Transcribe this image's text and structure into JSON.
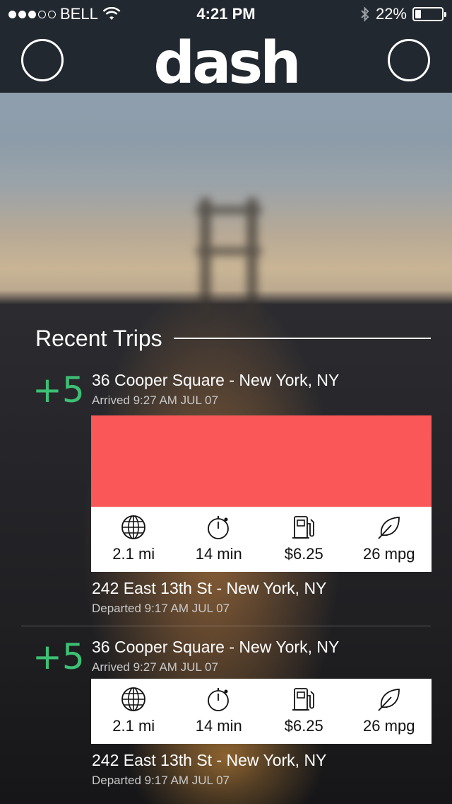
{
  "status_bar": {
    "carrier": "BELL",
    "time": "4:21 PM",
    "battery": "22%",
    "battery_level": 0.22,
    "signal_bars_filled": 3,
    "signal_bars_total": 5
  },
  "header": {
    "logo": "dash"
  },
  "recent_trips": {
    "title": "Recent Trips",
    "trips": [
      {
        "score": "+5",
        "destination": "36 Cooper Square - New York, NY",
        "arrived": "Arrived 9:27 AM JUL 07",
        "origin": "242 East 13th St - New York, NY",
        "departed": "Departed 9:17 AM JUL 07",
        "distance": "2.1 mi",
        "duration": "14 min",
        "cost": "$6.25",
        "efficiency": "26 mpg",
        "map_color": "#fa5759"
      },
      {
        "score": "+5",
        "destination": "36 Cooper Square - New York, NY",
        "arrived": "Arrived 9:27 AM JUL 07",
        "origin": "242 East 13th St - New York, NY",
        "departed": "Departed 9:17 AM JUL 07",
        "distance": "2.1 mi",
        "duration": "14 min",
        "cost": "$6.25",
        "efficiency": "26 mpg"
      }
    ]
  },
  "colors": {
    "accent_green": "#3dbf74",
    "header_bg": "#22282f",
    "map_red": "#fa5759"
  },
  "icons": [
    "globe-icon",
    "stopwatch-icon",
    "fuel-pump-icon",
    "leaf-icon",
    "wifi-icon",
    "bluetooth-icon",
    "battery-icon"
  ]
}
